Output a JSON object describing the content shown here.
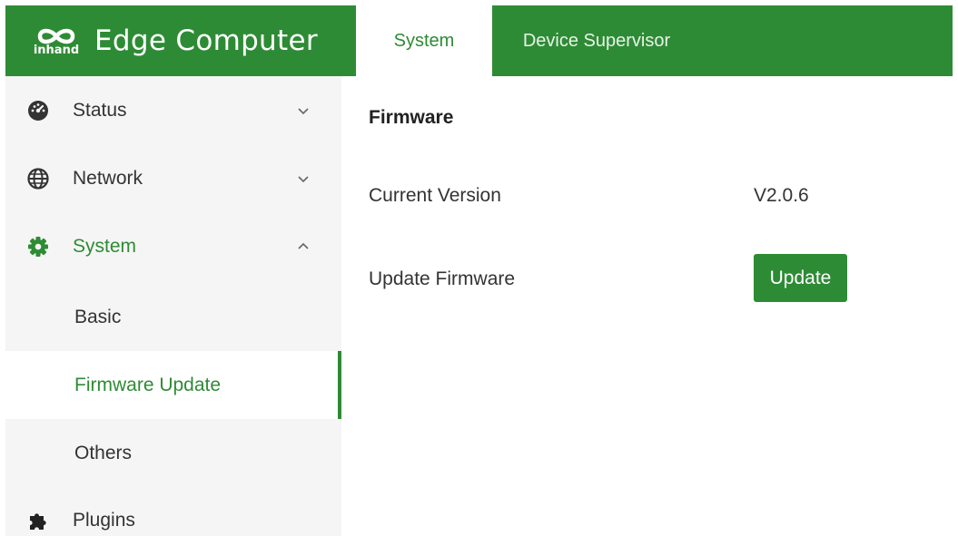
{
  "app": {
    "logo_text": "inhand",
    "title": "Edge Computer"
  },
  "header": {
    "tabs": [
      {
        "label": "System",
        "active": true
      },
      {
        "label": "Device Supervisor",
        "active": false
      }
    ]
  },
  "sidebar": {
    "items": [
      {
        "label": "Status",
        "icon": "dashboard-icon",
        "chevron": "down"
      },
      {
        "label": "Network",
        "icon": "globe-icon",
        "chevron": "down"
      },
      {
        "label": "System",
        "icon": "gear-icon",
        "chevron": "up",
        "open": true
      },
      {
        "label": "Plugins",
        "icon": "puzzle-icon"
      }
    ],
    "system_subitems": [
      {
        "label": "Basic",
        "active": false
      },
      {
        "label": "Firmware Update",
        "active": true
      },
      {
        "label": "Others",
        "active": false
      }
    ]
  },
  "main": {
    "section_title": "Firmware",
    "current_version_label": "Current Version",
    "current_version_value": "V2.0.6",
    "update_firmware_label": "Update Firmware",
    "update_button_label": "Update"
  },
  "colors": {
    "brand_green": "#2e8b35",
    "sidebar_bg": "#f5f5f5",
    "text": "#333333"
  }
}
